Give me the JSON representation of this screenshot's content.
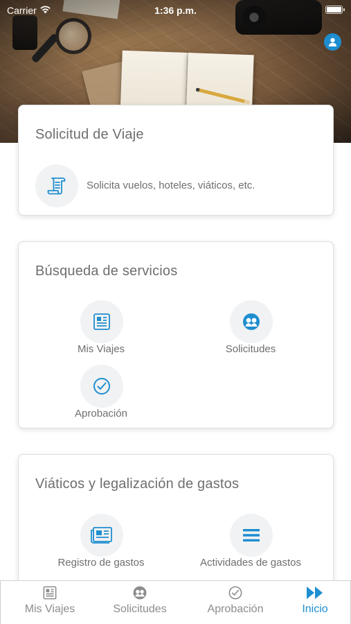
{
  "status_bar": {
    "carrier": "Carrier",
    "time": "1:36 p.m."
  },
  "header": {
    "profile_icon": "user-circle-icon",
    "accent_color": "#1d8ed0"
  },
  "travel_request": {
    "title": "Solicitud de Viaje",
    "item": {
      "icon": "document-scroll-icon",
      "label": "Solicita vuelos, hoteles, viáticos, etc."
    }
  },
  "service_search": {
    "title": "Búsqueda de servicios",
    "items": [
      {
        "icon": "newspaper-icon",
        "label": "Mis Viajes"
      },
      {
        "icon": "people-icon",
        "label": "Solicitudes"
      },
      {
        "icon": "check-circle-icon",
        "label": "Aprobación"
      }
    ]
  },
  "expenses": {
    "title": "Viáticos y legalización de gastos",
    "items": [
      {
        "icon": "receipt-icon",
        "label": "Registro de gastos"
      },
      {
        "icon": "menu-lines-icon",
        "label": "Actividades de gastos"
      }
    ]
  },
  "tab_bar": {
    "tabs": [
      {
        "icon": "newspaper-icon",
        "label": "Mis Viajes",
        "active": false
      },
      {
        "icon": "people-icon",
        "label": "Solicitudes",
        "active": false
      },
      {
        "icon": "check-circle-icon",
        "label": "Aprobación",
        "active": false
      },
      {
        "icon": "fast-forward-icon",
        "label": "Inicio",
        "active": true
      }
    ]
  }
}
